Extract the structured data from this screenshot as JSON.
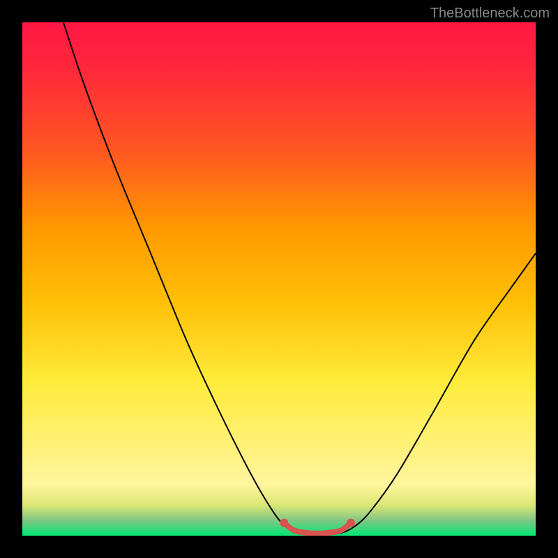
{
  "watermark": "TheBottleneck.com",
  "chart_data": {
    "type": "line",
    "title": "",
    "xlabel": "",
    "ylabel": "",
    "xlim": [
      0,
      100
    ],
    "ylim": [
      0,
      100
    ],
    "gradient_stops": [
      {
        "offset": 0,
        "color": "#ff1744"
      },
      {
        "offset": 10,
        "color": "#ff2a3a"
      },
      {
        "offset": 25,
        "color": "#ff5722"
      },
      {
        "offset": 40,
        "color": "#ff9800"
      },
      {
        "offset": 55,
        "color": "#ffc107"
      },
      {
        "offset": 70,
        "color": "#ffeb3b"
      },
      {
        "offset": 82,
        "color": "#fff176"
      },
      {
        "offset": 90,
        "color": "#fff59d"
      },
      {
        "offset": 94,
        "color": "#dce775"
      },
      {
        "offset": 97,
        "color": "#81c784"
      },
      {
        "offset": 100,
        "color": "#00e676"
      }
    ],
    "series": [
      {
        "name": "bottleneck-curve",
        "color": "#000000",
        "points": [
          {
            "x": 8,
            "y": 100
          },
          {
            "x": 12,
            "y": 88
          },
          {
            "x": 18,
            "y": 72
          },
          {
            "x": 25,
            "y": 55
          },
          {
            "x": 32,
            "y": 38
          },
          {
            "x": 38,
            "y": 25
          },
          {
            "x": 44,
            "y": 13
          },
          {
            "x": 48,
            "y": 6
          },
          {
            "x": 51,
            "y": 2
          },
          {
            "x": 54,
            "y": 0.5
          },
          {
            "x": 58,
            "y": 0.3
          },
          {
            "x": 62,
            "y": 0.5
          },
          {
            "x": 65,
            "y": 2
          },
          {
            "x": 68,
            "y": 5
          },
          {
            "x": 73,
            "y": 12
          },
          {
            "x": 80,
            "y": 24
          },
          {
            "x": 88,
            "y": 38
          },
          {
            "x": 95,
            "y": 48
          },
          {
            "x": 100,
            "y": 55
          }
        ]
      },
      {
        "name": "bottom-highlight",
        "color": "#d9534f",
        "stroke_width": 8,
        "points": [
          {
            "x": 51,
            "y": 2.5
          },
          {
            "x": 53,
            "y": 1
          },
          {
            "x": 56,
            "y": 0.5
          },
          {
            "x": 59,
            "y": 0.5
          },
          {
            "x": 62,
            "y": 1
          },
          {
            "x": 64,
            "y": 2.5
          }
        ]
      }
    ]
  }
}
